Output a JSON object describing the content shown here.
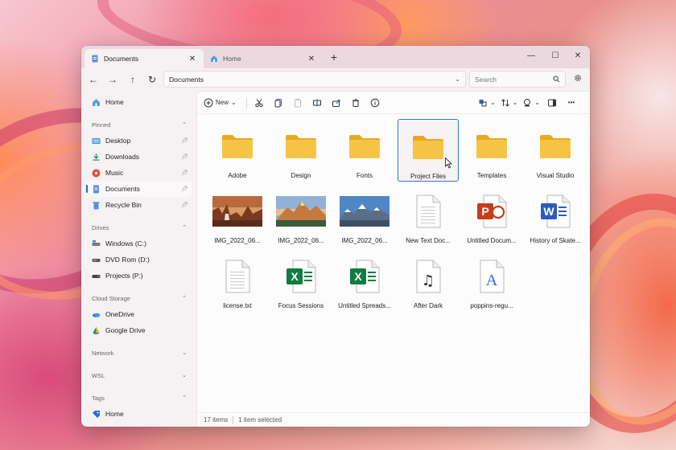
{
  "tabs": [
    {
      "label": "Documents",
      "active": true
    },
    {
      "label": "Home",
      "active": false
    }
  ],
  "window_controls": {
    "minimize": "—",
    "maximize": "☐",
    "close": "✕"
  },
  "nav": {
    "back": "←",
    "forward": "→",
    "up": "↑",
    "refresh": "↻"
  },
  "address": {
    "path": "Documents"
  },
  "search": {
    "placeholder": "Search"
  },
  "sidebar": {
    "home": {
      "label": "Home",
      "icon": "home-icon"
    },
    "sections": [
      {
        "title": "Pinned",
        "items": [
          {
            "label": "Desktop",
            "icon": "desktop-icon",
            "pinned": true
          },
          {
            "label": "Downloads",
            "icon": "downloads-icon",
            "pinned": true
          },
          {
            "label": "Music",
            "icon": "music-icon",
            "pinned": true
          },
          {
            "label": "Documents",
            "icon": "documents-icon",
            "pinned": true,
            "selected": true
          },
          {
            "label": "Recycle Bin",
            "icon": "recycle-bin-icon",
            "pinned": true
          }
        ]
      },
      {
        "title": "Drives",
        "items": [
          {
            "label": "Windows (C:)",
            "icon": "drive-icon"
          },
          {
            "label": "DVD Rom (D:)",
            "icon": "dvd-drive-icon"
          },
          {
            "label": "Projects (P:)",
            "icon": "drive-icon"
          }
        ]
      },
      {
        "title": "Cloud Storage",
        "items": [
          {
            "label": "OneDrive",
            "icon": "onedrive-icon"
          },
          {
            "label": "Google Drive",
            "icon": "google-drive-icon"
          }
        ]
      },
      {
        "title": "Network",
        "items": []
      },
      {
        "title": "WSL",
        "items": []
      },
      {
        "title": "Tags",
        "items": [
          {
            "label": "Home",
            "icon": "tag-icon"
          }
        ]
      }
    ]
  },
  "toolbar": {
    "new_label": "New"
  },
  "files": [
    {
      "name": "Adobe",
      "type": "folder"
    },
    {
      "name": "Design",
      "type": "folder"
    },
    {
      "name": "Fonts",
      "type": "folder"
    },
    {
      "name": "Project Files",
      "type": "folder",
      "selected": true
    },
    {
      "name": "Templates",
      "type": "folder"
    },
    {
      "name": "Visual Studio",
      "type": "folder"
    },
    {
      "name": "IMG_2022_06...",
      "type": "image",
      "scene": "canyon"
    },
    {
      "name": "IMG_2022_06...",
      "type": "image",
      "scene": "mountain-sunset"
    },
    {
      "name": "IMG_2022_06...",
      "type": "image",
      "scene": "snowy-mountains"
    },
    {
      "name": "New Text Doc...",
      "type": "text"
    },
    {
      "name": "Untitled Docum...",
      "type": "powerpoint",
      "glyph": "P"
    },
    {
      "name": "History of Skate...",
      "type": "word",
      "glyph": "W"
    },
    {
      "name": "license.txt",
      "type": "text"
    },
    {
      "name": "Focus Sessions",
      "type": "excel",
      "glyph": "X"
    },
    {
      "name": "Untitled Spreads...",
      "type": "excel",
      "glyph": "X"
    },
    {
      "name": "After Dark",
      "type": "music",
      "glyph": "♫"
    },
    {
      "name": "poppins-regu...",
      "type": "font",
      "glyph": "A"
    }
  ],
  "status": {
    "item_count": "17 items",
    "selection": "1 item selected"
  },
  "colors": {
    "accent": "#2563d8",
    "folder": "#f6c445",
    "excel": "#107c41",
    "word": "#2b5cbc",
    "powerpoint": "#c43e1c"
  }
}
